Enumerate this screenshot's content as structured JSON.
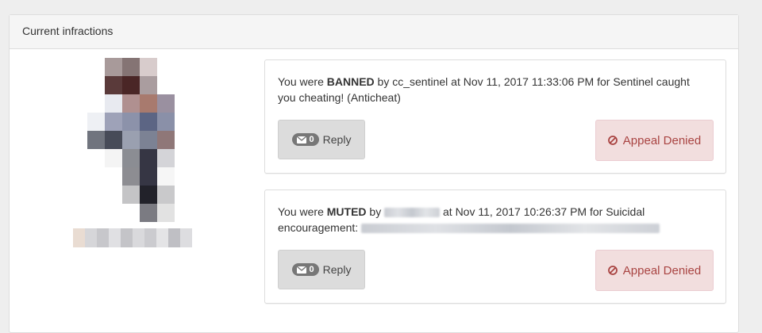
{
  "panel": {
    "title": "Current infractions"
  },
  "infractions": [
    {
      "prefix": "You were ",
      "type": "BANNED",
      "by_prefix": " by ",
      "by": "cc_sentinel",
      "at_text": " at Nov 11, 2017 11:33:06 PM for Sentinel caught you cheating! (Anticheat)",
      "reply_count": "0",
      "reply_label": "Reply",
      "appeal_label": "Appeal Denied"
    },
    {
      "prefix": "You were ",
      "type": "MUTED",
      "by_prefix": " by ",
      "at_text": " at Nov 11, 2017 10:26:37 PM for Suicidal encouragement: ",
      "reply_count": "0",
      "reply_label": "Reply",
      "appeal_label": "Appeal Denied"
    }
  ],
  "icons": {
    "envelope": "envelope-icon",
    "appeal": "ban-icon"
  },
  "colors": {
    "appeal_bg": "#f2dede",
    "appeal_text": "#a94442",
    "reply_bg": "#dcdcdc",
    "badge_bg": "#777777"
  }
}
